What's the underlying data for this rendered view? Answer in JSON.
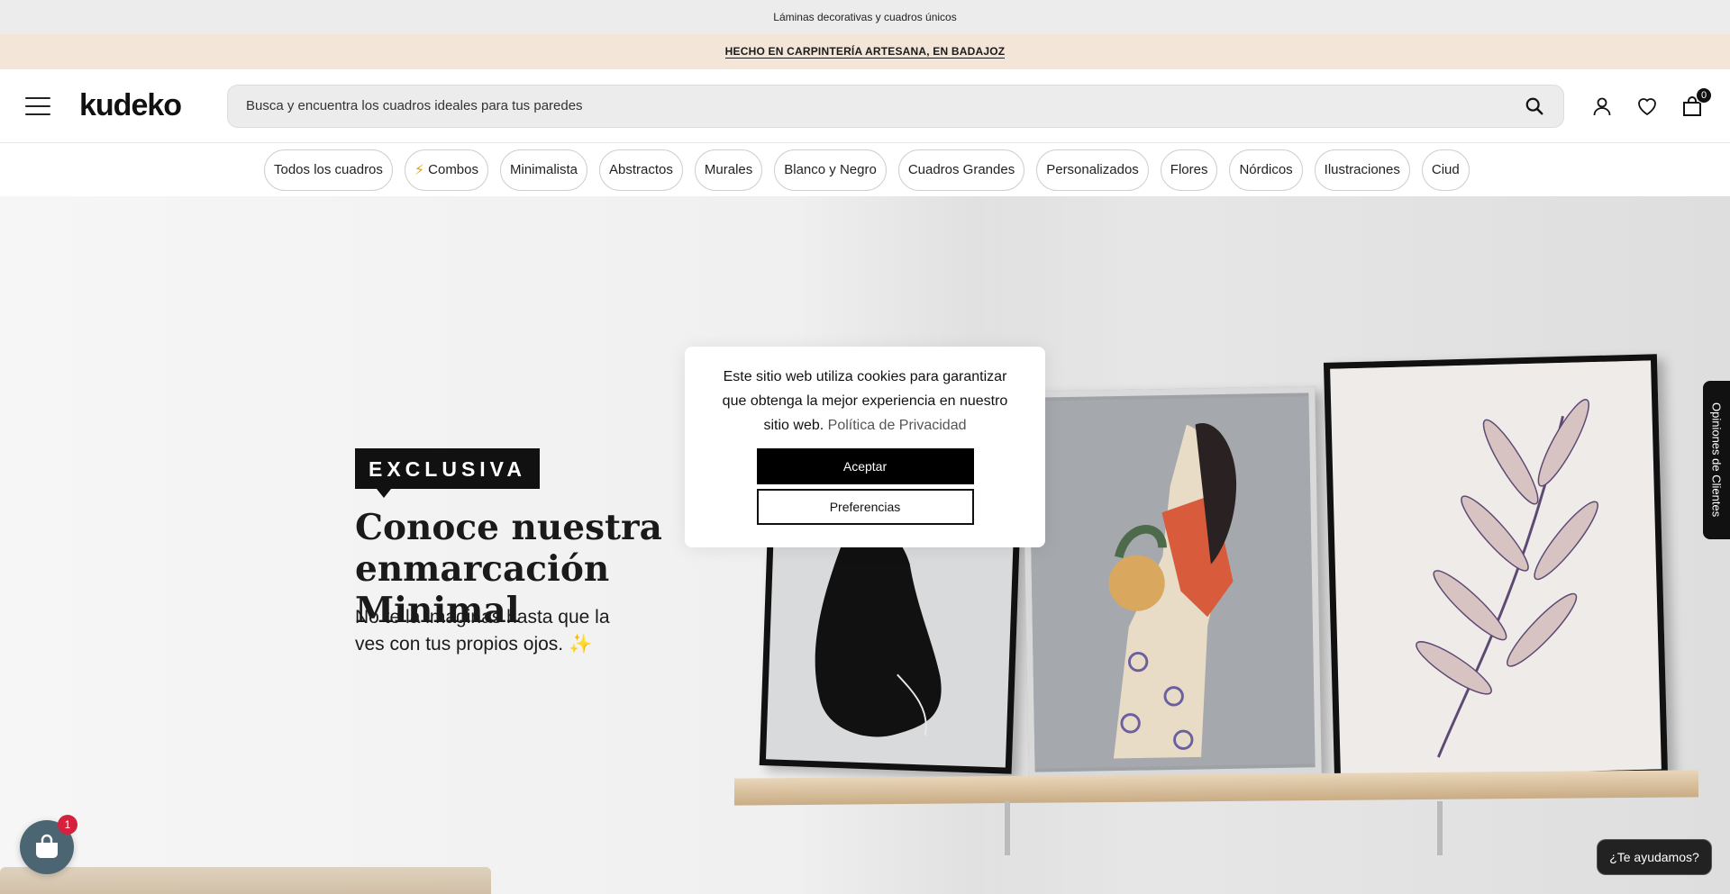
{
  "topbar": {
    "text": "Láminas decorativas y cuadros únicos"
  },
  "promo": {
    "text": "HECHO EN CARPINTERÍA ARTESANA, EN BADAJOZ"
  },
  "header": {
    "logo": "kudeko",
    "search_placeholder": "Busca y encuentra los cuadros ideales para tus paredes",
    "cart_count": "0"
  },
  "categories": [
    "Todos los cuadros",
    "Combos",
    "Minimalista",
    "Abstractos",
    "Murales",
    "Blanco y Negro",
    "Cuadros Grandes",
    "Personalizados",
    "Flores",
    "Nórdicos",
    "Ilustraciones",
    "Ciud"
  ],
  "hero": {
    "badge": "EXCLUSIVA",
    "title": "Conoce nuestra enmarcación Minimal",
    "subtitle": "No te la imaginas hasta que la ves con tus propios ojos. ✨"
  },
  "cookie": {
    "message": "Este sitio web utiliza cookies para garantizar que obtenga la mejor experiencia en nuestro sitio web.",
    "policy_link": "Política de Privacidad",
    "accept": "Aceptar",
    "preferences": "Preferencias"
  },
  "reviews_tab": "Opiniones de Clientes",
  "help_button": "¿Te ayudamos?",
  "chat": {
    "badge": "1"
  },
  "colors": {
    "promo_bg": "#f3e6d8",
    "topbar_bg": "#ececec",
    "primary": "#111111",
    "chat": "#4c6572",
    "badge_red": "#d4213d"
  }
}
